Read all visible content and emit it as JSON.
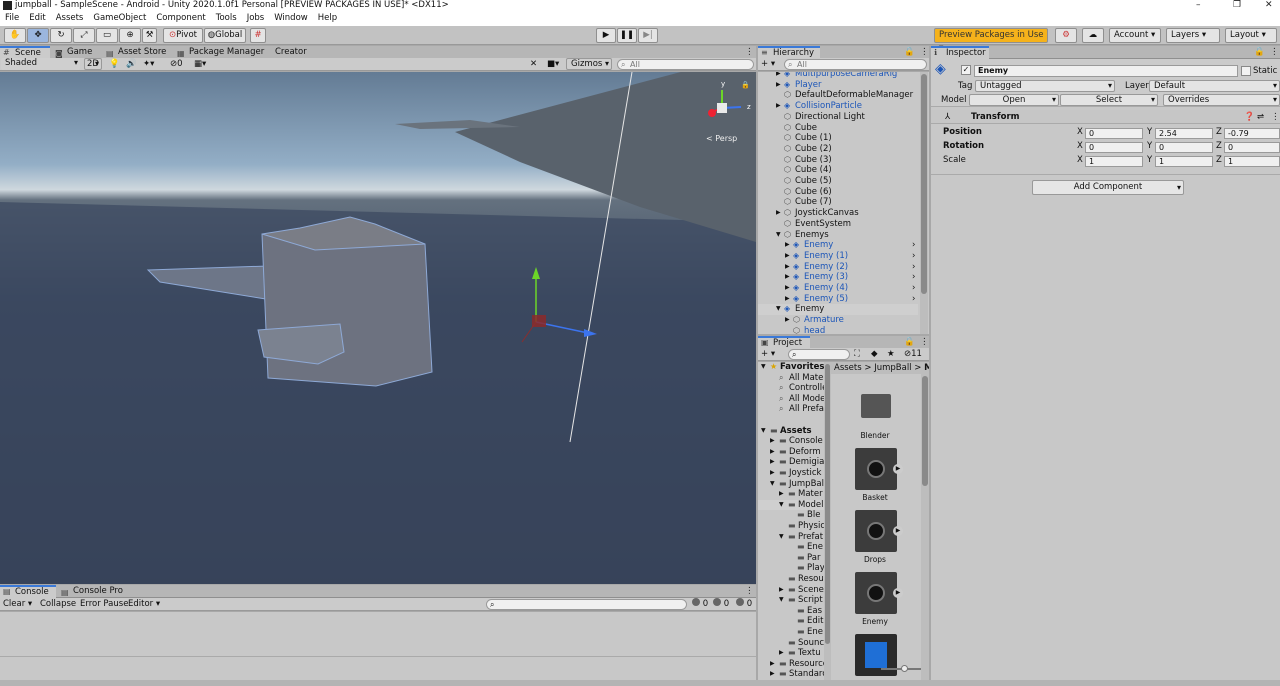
{
  "window": {
    "title": "jumpball - SampleScene - Android - Unity 2020.1.0f1 Personal [PREVIEW PACKAGES IN USE]* <DX11>",
    "minimize": "–",
    "restore": "❐",
    "close": "✕"
  },
  "menu": [
    "File",
    "Edit",
    "Assets",
    "GameObject",
    "Component",
    "Tools",
    "Jobs",
    "Window",
    "Help"
  ],
  "toolbar": {
    "pivot": "Pivot",
    "global": "Global",
    "preview_packages": "Preview Packages in Use",
    "account": "Account",
    "layers": "Layers",
    "layout": "Layout"
  },
  "scene": {
    "tabs": [
      "Scene",
      "Game",
      "Asset Store",
      "Package Manager",
      "Creator"
    ],
    "shading": "Shaded",
    "mode_2d": "2D",
    "hidden_count": "0",
    "gizmos": "Gizmos",
    "search_placeholder": "All",
    "persp": "< Persp",
    "axis_y": "y",
    "axis_z": "z"
  },
  "console": {
    "tabs": [
      "Console",
      "Console Pro"
    ],
    "clear": "Clear",
    "collapse": "Collapse",
    "error_pause": "Error Pause",
    "editor": "Editor",
    "info_count": "0",
    "warn_count": "0",
    "error_count": "0"
  },
  "hierarchy": {
    "title": "Hierarchy",
    "search_placeholder": "All",
    "items": [
      {
        "label": "MultipurposeCameraRig",
        "indent": 1,
        "blue": true,
        "arrow": "▶",
        "prefab": true
      },
      {
        "label": "Player",
        "indent": 1,
        "blue": true,
        "arrow": "▶",
        "prefab": true
      },
      {
        "label": "DefaultDeformableManager",
        "indent": 1,
        "blue": false,
        "arrow": "",
        "prefab": false
      },
      {
        "label": "CollisionParticle",
        "indent": 1,
        "blue": true,
        "arrow": "▶",
        "prefab": true
      },
      {
        "label": "Directional Light",
        "indent": 1,
        "blue": false,
        "arrow": "",
        "prefab": false
      },
      {
        "label": "Cube",
        "indent": 1,
        "blue": false,
        "arrow": "",
        "prefab": false
      },
      {
        "label": "Cube (1)",
        "indent": 1,
        "blue": false,
        "arrow": "",
        "prefab": false
      },
      {
        "label": "Cube (2)",
        "indent": 1,
        "blue": false,
        "arrow": "",
        "prefab": false
      },
      {
        "label": "Cube (3)",
        "indent": 1,
        "blue": false,
        "arrow": "",
        "prefab": false
      },
      {
        "label": "Cube (4)",
        "indent": 1,
        "blue": false,
        "arrow": "",
        "prefab": false
      },
      {
        "label": "Cube (5)",
        "indent": 1,
        "blue": false,
        "arrow": "",
        "prefab": false
      },
      {
        "label": "Cube (6)",
        "indent": 1,
        "blue": false,
        "arrow": "",
        "prefab": false
      },
      {
        "label": "Cube (7)",
        "indent": 1,
        "blue": false,
        "arrow": "",
        "prefab": false
      },
      {
        "label": "JoystickCanvas",
        "indent": 1,
        "blue": false,
        "arrow": "▶",
        "prefab": false
      },
      {
        "label": "EventSystem",
        "indent": 1,
        "blue": false,
        "arrow": "",
        "prefab": false
      },
      {
        "label": "Enemys",
        "indent": 1,
        "blue": false,
        "arrow": "▼",
        "prefab": false
      },
      {
        "label": "Enemy",
        "indent": 2,
        "blue": true,
        "arrow": "▶",
        "prefab": true
      },
      {
        "label": "Enemy (1)",
        "indent": 2,
        "blue": true,
        "arrow": "▶",
        "prefab": true
      },
      {
        "label": "Enemy (2)",
        "indent": 2,
        "blue": true,
        "arrow": "▶",
        "prefab": true
      },
      {
        "label": "Enemy (3)",
        "indent": 2,
        "blue": true,
        "arrow": "▶",
        "prefab": true
      },
      {
        "label": "Enemy (4)",
        "indent": 2,
        "blue": true,
        "arrow": "▶",
        "prefab": true
      },
      {
        "label": "Enemy (5)",
        "indent": 2,
        "blue": true,
        "arrow": "▶",
        "prefab": true
      },
      {
        "label": "Enemy",
        "indent": 1,
        "blue": false,
        "arrow": "▼",
        "prefab": true,
        "selected": true
      },
      {
        "label": "Armature",
        "indent": 2,
        "blue": true,
        "arrow": "▶",
        "prefab": false
      },
      {
        "label": "head",
        "indent": 2,
        "blue": true,
        "arrow": "",
        "prefab": false
      }
    ]
  },
  "project": {
    "title": "Project",
    "hidden_count": "11",
    "breadcrumb": [
      "Assets",
      "JumpBall",
      "Mo"
    ],
    "tree": [
      {
        "label": "Favorites",
        "indent": 0,
        "arrow": "▼",
        "bold": true,
        "star": true
      },
      {
        "label": "All Mater",
        "indent": 1,
        "arrow": "",
        "search": true
      },
      {
        "label": "Controlle",
        "indent": 1,
        "arrow": "",
        "search": true
      },
      {
        "label": "All Mode",
        "indent": 1,
        "arrow": "",
        "search": true
      },
      {
        "label": "All Prefa",
        "indent": 1,
        "arrow": "",
        "search": true
      },
      {
        "label": "",
        "indent": 0,
        "arrow": ""
      },
      {
        "label": "Assets",
        "indent": 0,
        "arrow": "▼",
        "bold": true
      },
      {
        "label": "Console",
        "indent": 1,
        "arrow": "▶"
      },
      {
        "label": "Deform",
        "indent": 1,
        "arrow": "▶"
      },
      {
        "label": "Demigia",
        "indent": 1,
        "arrow": "▶"
      },
      {
        "label": "Joystick",
        "indent": 1,
        "arrow": "▶"
      },
      {
        "label": "JumpBal",
        "indent": 1,
        "arrow": "▼"
      },
      {
        "label": "Mater",
        "indent": 2,
        "arrow": "▶"
      },
      {
        "label": "Model",
        "indent": 2,
        "arrow": "▼",
        "selected": true
      },
      {
        "label": "Ble",
        "indent": 3,
        "arrow": ""
      },
      {
        "label": "Physic",
        "indent": 2,
        "arrow": ""
      },
      {
        "label": "Prefat",
        "indent": 2,
        "arrow": "▼"
      },
      {
        "label": "Ene",
        "indent": 3,
        "arrow": ""
      },
      {
        "label": "Par",
        "indent": 3,
        "arrow": ""
      },
      {
        "label": "Play",
        "indent": 3,
        "arrow": ""
      },
      {
        "label": "Resou",
        "indent": 2,
        "arrow": ""
      },
      {
        "label": "Scene",
        "indent": 2,
        "arrow": "▶"
      },
      {
        "label": "Script",
        "indent": 2,
        "arrow": "▼"
      },
      {
        "label": "Eas",
        "indent": 3,
        "arrow": ""
      },
      {
        "label": "Edit",
        "indent": 3,
        "arrow": ""
      },
      {
        "label": "Ene",
        "indent": 3,
        "arrow": ""
      },
      {
        "label": "Sounc",
        "indent": 2,
        "arrow": ""
      },
      {
        "label": "Textu",
        "indent": 2,
        "arrow": "▶"
      },
      {
        "label": "Resource",
        "indent": 1,
        "arrow": "▶"
      },
      {
        "label": "Standarc",
        "indent": 1,
        "arrow": "▶"
      }
    ],
    "assets": [
      {
        "label": "Blender",
        "kind": "folder"
      },
      {
        "label": "Basket",
        "kind": "model"
      },
      {
        "label": "Drops",
        "kind": "model"
      },
      {
        "label": "Enemy",
        "kind": "model"
      },
      {
        "label": "",
        "kind": "prefab"
      }
    ]
  },
  "inspector": {
    "title": "Inspector",
    "object_name": "Enemy",
    "static_label": "Static",
    "tag_label": "Tag",
    "tag_value": "Untagged",
    "layer_label": "Layer",
    "layer_value": "Default",
    "model_label": "Model",
    "open": "Open",
    "select": "Select",
    "overrides": "Overrides",
    "transform_title": "Transform",
    "rows": [
      {
        "label": "Position",
        "x": "0",
        "y": "2.54",
        "z": "-0.79",
        "bold": true
      },
      {
        "label": "Rotation",
        "x": "0",
        "y": "0",
        "z": "0",
        "bold": true
      },
      {
        "label": "Scale",
        "x": "1",
        "y": "1",
        "z": "1",
        "bold": false
      }
    ],
    "axis_x": "X",
    "axis_y": "Y",
    "axis_z": "Z",
    "add_component": "Add Component"
  },
  "colors": {
    "accent": "#3a79d8",
    "prefab_blue": "#1b55b8",
    "preview_orange": "#f5b21b"
  }
}
